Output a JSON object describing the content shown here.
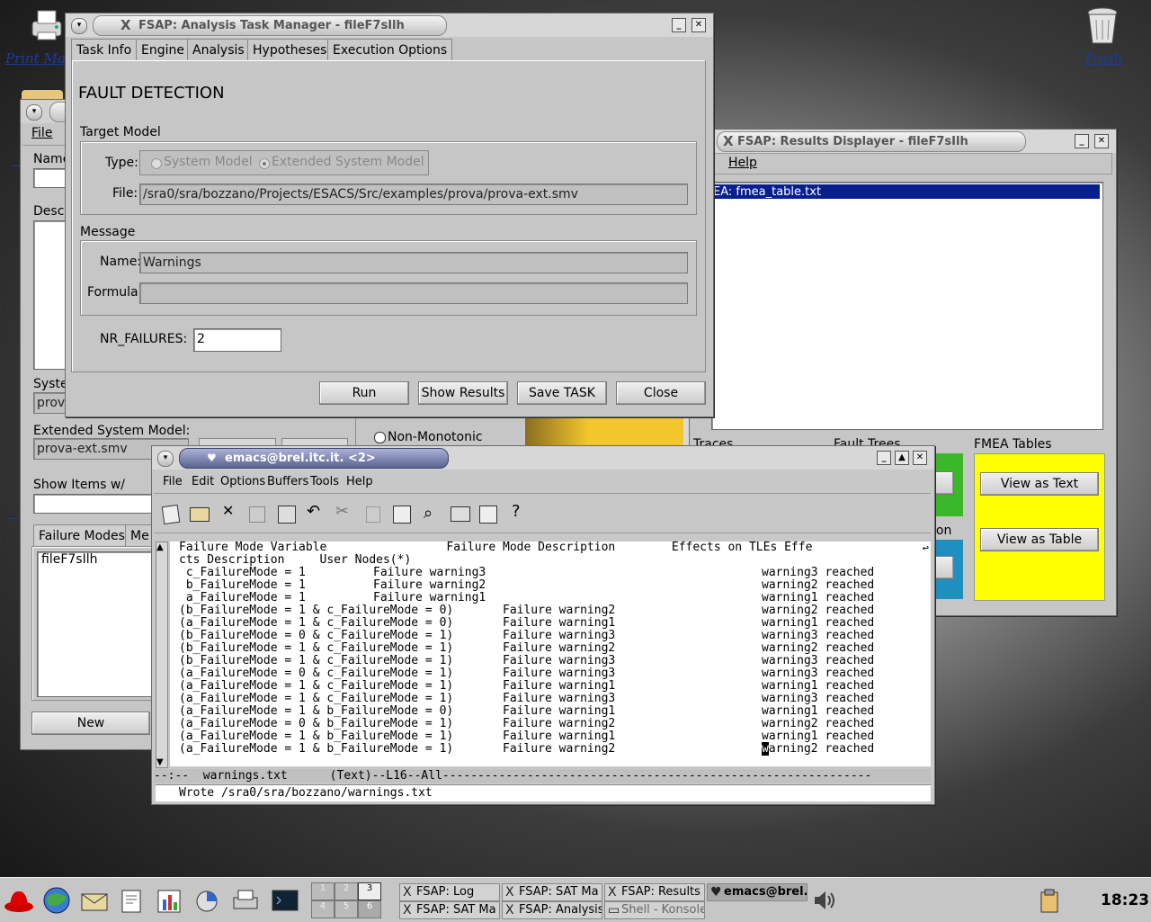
{
  "desktop": {
    "print_manager": "Print Man",
    "trash": "Trash"
  },
  "back_window": {
    "menu_file": "File",
    "name_label": "Name",
    "desc_label": "Descr",
    "system_label": "Syste",
    "system_value": "prova",
    "ext_label": "Extended System Model:",
    "ext_value": "prova-ext.smv",
    "non_monotonic": "Non-Monotonic",
    "show_items": "Show Items w/",
    "tab_failure_modes": "Failure Modes",
    "tab_me": "Me",
    "list_item": "fileF7sIlh",
    "new_button": "New"
  },
  "results_window": {
    "title": "FSAP: Results Displayer - fileF7sIlh",
    "menu_help": "Help",
    "list_item": "EA: fmea_table.txt",
    "traces_label": "Traces",
    "fault_trees_label": "Fault Trees",
    "fmea_label": "FMEA Tables",
    "ion_text": "ion",
    "view_as_text": "View as Text",
    "view_as_table": "View as Table",
    "colors": {
      "green": "#3bb82a",
      "blue": "#1f8fbf",
      "yellow": "#ffff00"
    }
  },
  "task_manager": {
    "title": "FSAP: Analysis Task Manager - fileF7sIlh",
    "tabs": [
      "Task Info",
      "Engine",
      "Analysis",
      "Hypotheses",
      "Execution Options"
    ],
    "heading": "FAULT DETECTION",
    "target_model_label": "Target Model",
    "type_label": "Type:",
    "type_option_system": "System Model",
    "type_option_extended": "Extended System Model",
    "file_label": "File:",
    "file_value": "/sra0/sra/bozzano/Projects/ESACS/Src/examples/prova/prova-ext.smv",
    "message_label": "Message",
    "name_label": "Name:",
    "name_value": "Warnings",
    "formula_label": "Formula:",
    "formula_value": "",
    "nr_failures_label": "NR_FAILURES:",
    "nr_failures_value": "2",
    "buttons": {
      "run": "Run",
      "show_results": "Show Results",
      "save_task": "Save TASK",
      "close": "Close"
    }
  },
  "emacs": {
    "title": "emacs@brel.itc.it. <2>",
    "menu": [
      "File",
      "Edit",
      "Options",
      "Buffers",
      "Tools",
      "Help"
    ],
    "header1": "Failure Mode Variable                 Failure Mode Description        Effects on TLEs Effe",
    "header2": "cts Description     User Nodes(*)",
    "rows": [
      {
        "variable": " c_FailureMode = 1       ",
        "description": "Failure warning3",
        "effect": "warning3 reached"
      },
      {
        "variable": " b_FailureMode = 1       ",
        "description": "Failure warning2",
        "effect": "warning2 reached"
      },
      {
        "variable": " a_FailureMode = 1       ",
        "description": "Failure warning1",
        "effect": "warning1 reached"
      },
      {
        "variable": "(b_FailureMode = 1 & c_FailureMode = 0) ",
        "description": "Failure warning2",
        "effect": "warning2 reached"
      },
      {
        "variable": "(a_FailureMode = 1 & c_FailureMode = 0) ",
        "description": "Failure warning1",
        "effect": "warning1 reached"
      },
      {
        "variable": "(b_FailureMode = 0 & c_FailureMode = 1) ",
        "description": "Failure warning3",
        "effect": "warning3 reached"
      },
      {
        "variable": "(b_FailureMode = 1 & c_FailureMode = 1) ",
        "description": "Failure warning2",
        "effect": "warning2 reached"
      },
      {
        "variable": "(b_FailureMode = 1 & c_FailureMode = 1) ",
        "description": "Failure warning3",
        "effect": "warning3 reached"
      },
      {
        "variable": "(a_FailureMode = 0 & c_FailureMode = 1) ",
        "description": "Failure warning3",
        "effect": "warning3 reached"
      },
      {
        "variable": "(a_FailureMode = 1 & c_FailureMode = 1) ",
        "description": "Failure warning1",
        "effect": "warning1 reached"
      },
      {
        "variable": "(a_FailureMode = 1 & c_FailureMode = 1) ",
        "description": "Failure warning3",
        "effect": "warning3 reached"
      },
      {
        "variable": "(a_FailureMode = 1 & b_FailureMode = 0) ",
        "description": "Failure warning1",
        "effect": "warning1 reached"
      },
      {
        "variable": "(a_FailureMode = 0 & b_FailureMode = 1) ",
        "description": "Failure warning2",
        "effect": "warning2 reached"
      },
      {
        "variable": "(a_FailureMode = 1 & b_FailureMode = 1) ",
        "description": "Failure warning1",
        "effect": "warning1 reached"
      },
      {
        "variable": "(a_FailureMode = 1 & b_FailureMode = 1) ",
        "description": "Failure warning2",
        "effect": "warning2 reached"
      }
    ],
    "modeline": "--:--  warnings.txt      (Text)--L16--All-------------------------------------------------------------",
    "minibuffer": "Wrote /sra0/sra/bozzano/warnings.txt"
  },
  "taskbar": {
    "pager": [
      "1",
      "2",
      "3",
      "4",
      "5",
      "6"
    ],
    "tasks_top": [
      "FSAP: Log",
      "FSAP: SAT Ma",
      "FSAP: Results",
      "emacs@brel.i"
    ],
    "tasks_bottom": [
      "FSAP: SAT Ma",
      "FSAP: Analysis",
      "Shell - Konsole"
    ],
    "clock": "18:23"
  }
}
